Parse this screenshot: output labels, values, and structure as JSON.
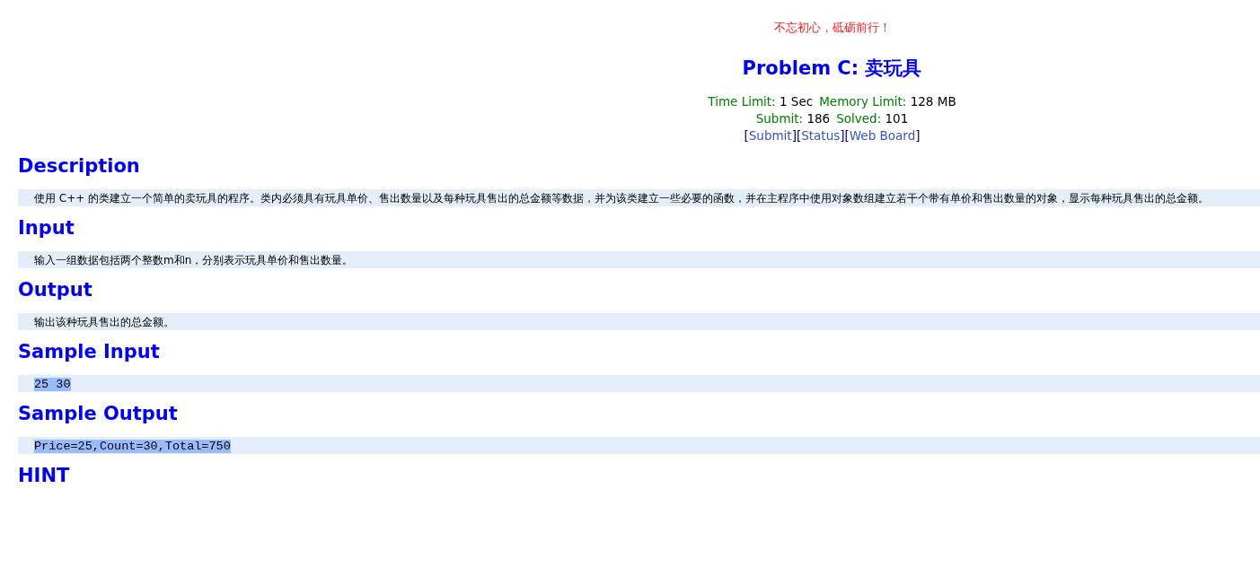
{
  "motto": "不忘初心，砥砺前行！",
  "title": "Problem C: 卖玩具",
  "meta_rows": [
    [
      {
        "label": "Time Limit:",
        "value": "1 Sec"
      },
      {
        "label": "Memory Limit:",
        "value": "128 MB"
      }
    ],
    [
      {
        "label": "Submit:",
        "value": "186"
      },
      {
        "label": "Solved:",
        "value": "101"
      }
    ]
  ],
  "links": [
    {
      "open": "[",
      "label": "Submit",
      "close": "]"
    },
    {
      "open": "[",
      "label": "Status",
      "close": "]"
    },
    {
      "open": "[",
      "label": "Web Board",
      "close": "]"
    }
  ],
  "sections": [
    {
      "heading": "Description",
      "kind": "text",
      "content": "使用 C++ 的类建立一个简单的卖玩具的程序。类内必须具有玩具单价、售出数量以及每种玩具售出的总金额等数据，并为该类建立一些必要的函数，并在主程序中使用对象数组建立若干个带有单价和售出数量的对象，显示每种玩具售出的总金额。"
    },
    {
      "heading": "Input",
      "kind": "text",
      "content": "输入一组数据包括两个整数m和n，分别表示玩具单价和售出数量。"
    },
    {
      "heading": "Output",
      "kind": "text",
      "content": "输出该种玩具售出的总金额。"
    },
    {
      "heading": "Sample Input",
      "kind": "code",
      "content": "25 30",
      "selected": true
    },
    {
      "heading": "Sample Output",
      "kind": "code",
      "content": "Price=25,Count=30,Total=750",
      "selected": true
    },
    {
      "heading": "HINT",
      "kind": "empty"
    }
  ]
}
